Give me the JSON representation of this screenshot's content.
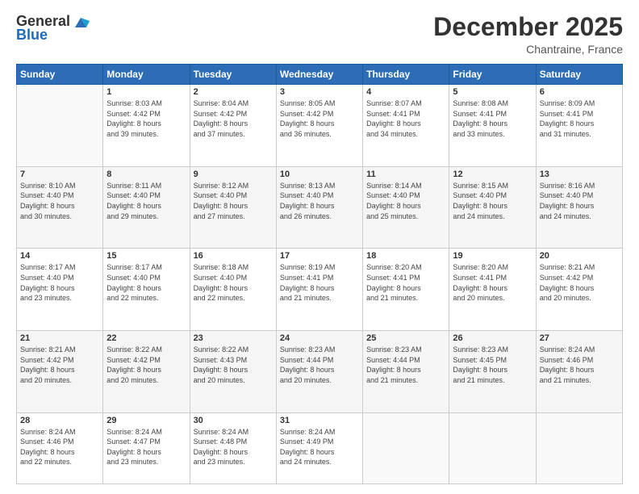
{
  "logo": {
    "general": "General",
    "blue": "Blue"
  },
  "header": {
    "month": "December 2025",
    "location": "Chantraine, France"
  },
  "days_of_week": [
    "Sunday",
    "Monday",
    "Tuesday",
    "Wednesday",
    "Thursday",
    "Friday",
    "Saturday"
  ],
  "weeks": [
    [
      {
        "day": "",
        "info": ""
      },
      {
        "day": "1",
        "info": "Sunrise: 8:03 AM\nSunset: 4:42 PM\nDaylight: 8 hours\nand 39 minutes."
      },
      {
        "day": "2",
        "info": "Sunrise: 8:04 AM\nSunset: 4:42 PM\nDaylight: 8 hours\nand 37 minutes."
      },
      {
        "day": "3",
        "info": "Sunrise: 8:05 AM\nSunset: 4:42 PM\nDaylight: 8 hours\nand 36 minutes."
      },
      {
        "day": "4",
        "info": "Sunrise: 8:07 AM\nSunset: 4:41 PM\nDaylight: 8 hours\nand 34 minutes."
      },
      {
        "day": "5",
        "info": "Sunrise: 8:08 AM\nSunset: 4:41 PM\nDaylight: 8 hours\nand 33 minutes."
      },
      {
        "day": "6",
        "info": "Sunrise: 8:09 AM\nSunset: 4:41 PM\nDaylight: 8 hours\nand 31 minutes."
      }
    ],
    [
      {
        "day": "7",
        "info": "Sunrise: 8:10 AM\nSunset: 4:40 PM\nDaylight: 8 hours\nand 30 minutes."
      },
      {
        "day": "8",
        "info": "Sunrise: 8:11 AM\nSunset: 4:40 PM\nDaylight: 8 hours\nand 29 minutes."
      },
      {
        "day": "9",
        "info": "Sunrise: 8:12 AM\nSunset: 4:40 PM\nDaylight: 8 hours\nand 27 minutes."
      },
      {
        "day": "10",
        "info": "Sunrise: 8:13 AM\nSunset: 4:40 PM\nDaylight: 8 hours\nand 26 minutes."
      },
      {
        "day": "11",
        "info": "Sunrise: 8:14 AM\nSunset: 4:40 PM\nDaylight: 8 hours\nand 25 minutes."
      },
      {
        "day": "12",
        "info": "Sunrise: 8:15 AM\nSunset: 4:40 PM\nDaylight: 8 hours\nand 24 minutes."
      },
      {
        "day": "13",
        "info": "Sunrise: 8:16 AM\nSunset: 4:40 PM\nDaylight: 8 hours\nand 24 minutes."
      }
    ],
    [
      {
        "day": "14",
        "info": "Sunrise: 8:17 AM\nSunset: 4:40 PM\nDaylight: 8 hours\nand 23 minutes."
      },
      {
        "day": "15",
        "info": "Sunrise: 8:17 AM\nSunset: 4:40 PM\nDaylight: 8 hours\nand 22 minutes."
      },
      {
        "day": "16",
        "info": "Sunrise: 8:18 AM\nSunset: 4:40 PM\nDaylight: 8 hours\nand 22 minutes."
      },
      {
        "day": "17",
        "info": "Sunrise: 8:19 AM\nSunset: 4:41 PM\nDaylight: 8 hours\nand 21 minutes."
      },
      {
        "day": "18",
        "info": "Sunrise: 8:20 AM\nSunset: 4:41 PM\nDaylight: 8 hours\nand 21 minutes."
      },
      {
        "day": "19",
        "info": "Sunrise: 8:20 AM\nSunset: 4:41 PM\nDaylight: 8 hours\nand 20 minutes."
      },
      {
        "day": "20",
        "info": "Sunrise: 8:21 AM\nSunset: 4:42 PM\nDaylight: 8 hours\nand 20 minutes."
      }
    ],
    [
      {
        "day": "21",
        "info": "Sunrise: 8:21 AM\nSunset: 4:42 PM\nDaylight: 8 hours\nand 20 minutes."
      },
      {
        "day": "22",
        "info": "Sunrise: 8:22 AM\nSunset: 4:42 PM\nDaylight: 8 hours\nand 20 minutes."
      },
      {
        "day": "23",
        "info": "Sunrise: 8:22 AM\nSunset: 4:43 PM\nDaylight: 8 hours\nand 20 minutes."
      },
      {
        "day": "24",
        "info": "Sunrise: 8:23 AM\nSunset: 4:44 PM\nDaylight: 8 hours\nand 20 minutes."
      },
      {
        "day": "25",
        "info": "Sunrise: 8:23 AM\nSunset: 4:44 PM\nDaylight: 8 hours\nand 21 minutes."
      },
      {
        "day": "26",
        "info": "Sunrise: 8:23 AM\nSunset: 4:45 PM\nDaylight: 8 hours\nand 21 minutes."
      },
      {
        "day": "27",
        "info": "Sunrise: 8:24 AM\nSunset: 4:46 PM\nDaylight: 8 hours\nand 21 minutes."
      }
    ],
    [
      {
        "day": "28",
        "info": "Sunrise: 8:24 AM\nSunset: 4:46 PM\nDaylight: 8 hours\nand 22 minutes."
      },
      {
        "day": "29",
        "info": "Sunrise: 8:24 AM\nSunset: 4:47 PM\nDaylight: 8 hours\nand 23 minutes."
      },
      {
        "day": "30",
        "info": "Sunrise: 8:24 AM\nSunset: 4:48 PM\nDaylight: 8 hours\nand 23 minutes."
      },
      {
        "day": "31",
        "info": "Sunrise: 8:24 AM\nSunset: 4:49 PM\nDaylight: 8 hours\nand 24 minutes."
      },
      {
        "day": "",
        "info": ""
      },
      {
        "day": "",
        "info": ""
      },
      {
        "day": "",
        "info": ""
      }
    ]
  ]
}
